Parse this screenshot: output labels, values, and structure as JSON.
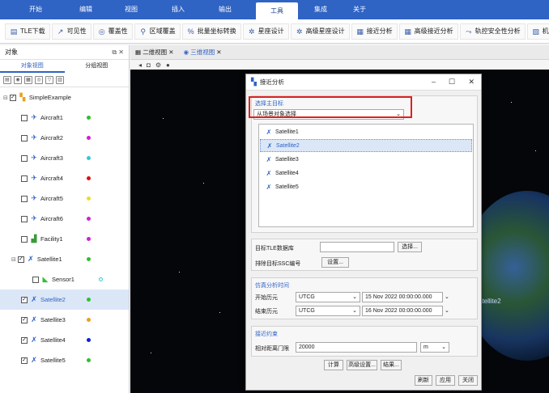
{
  "menu": [
    "开始",
    "编辑",
    "视图",
    "插入",
    "输出",
    "工具",
    "集成",
    "关于"
  ],
  "menu_active": "工具",
  "toolbar": [
    {
      "label": "TLE下载",
      "icon": "tle-icon"
    },
    {
      "label": "可见性",
      "icon": "visibility-icon"
    },
    {
      "label": "覆盖性",
      "icon": "coverage-icon"
    },
    {
      "label": "区域覆盖",
      "icon": "area-coverage-icon"
    },
    {
      "label": "批量坐标转换",
      "icon": "coordinate-icon"
    },
    {
      "label": "星座设计",
      "icon": "constellation-icon"
    },
    {
      "label": "高级星座设计",
      "icon": "advanced-constellation-icon"
    },
    {
      "label": "接近分析",
      "icon": "approach-icon"
    },
    {
      "label": "高级接近分析",
      "icon": "advanced-approach-icon"
    },
    {
      "label": "轨控安全性分析",
      "icon": "orbit-safety-icon"
    },
    {
      "label": "机动分析",
      "icon": "maneuver-icon"
    }
  ],
  "left_panel": {
    "title": "对象",
    "tabs": [
      "对象视图",
      "分组视图"
    ],
    "root": "SimpleExample",
    "items": [
      {
        "name": "Aircraft1",
        "color": "#2ec02e"
      },
      {
        "name": "Aircraft2",
        "color": "#d020d0"
      },
      {
        "name": "Aircraft3",
        "color": "#30c8d8"
      },
      {
        "name": "Aircraft4",
        "color": "#e01010"
      },
      {
        "name": "Aircraft5",
        "color": "#e8e020"
      },
      {
        "name": "Aircraft6",
        "color": "#d020d0"
      },
      {
        "name": "Facility1",
        "color": "#d020d0"
      },
      {
        "name": "Satellite1",
        "color": "#2ec02e"
      },
      {
        "name": "Sensor1",
        "color": "#30c8d8"
      },
      {
        "name": "Satellite2",
        "color": "#2ec02e"
      },
      {
        "name": "Satellite3",
        "color": "#e8a020"
      },
      {
        "name": "Satellite4",
        "color": "#1020d0"
      },
      {
        "name": "Satellite5",
        "color": "#2ec02e"
      }
    ]
  },
  "view_tabs": [
    "二维视图",
    "三维视图"
  ],
  "view_sat_label": "atellite2",
  "dialog": {
    "title": "接近分析",
    "target_label": "选择主目标",
    "source_select": "从场景对象选择",
    "satellites": [
      "Satellite1",
      "Satellite2",
      "Satellite3",
      "Satellite4",
      "Satellite5"
    ],
    "selected": "Satellite2",
    "tle_db_label": "目标TLE数据库",
    "select_btn": "选择...",
    "exclude_label": "排除目标SSC编号",
    "settings_btn": "设置...",
    "sim_title": "仿真分析时间",
    "start_label": "开始历元",
    "end_label": "结束历元",
    "timescale": "UTCG",
    "start_time": "15 Nov 2022 00:00:00.000",
    "end_time": "16 Nov 2022 00:00:00.000",
    "constraint_title": "接近约束",
    "range_label": "相对距离门限",
    "range_value": "20000",
    "range_unit": "m",
    "compute_btn": "计算",
    "adv_btn": "高级设置...",
    "result_btn": "结果...",
    "refresh_btn": "刷新",
    "apply_btn": "应用",
    "close_btn": "关闭"
  }
}
